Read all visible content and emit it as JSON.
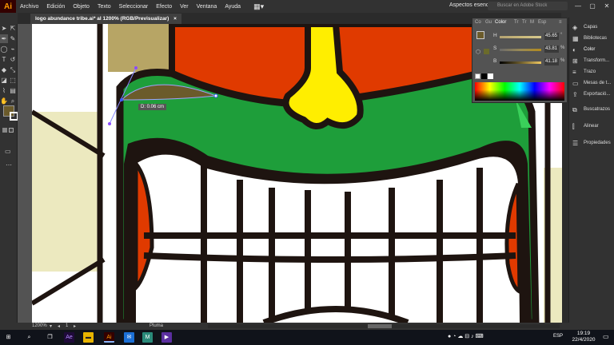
{
  "app": {
    "logo": "Ai",
    "workspace": "Aspectos esenciales",
    "search_placeholder": "Buscar en Adobe Stock"
  },
  "menu": [
    "Archivo",
    "Edición",
    "Objeto",
    "Texto",
    "Seleccionar",
    "Efecto",
    "Ver",
    "Ventana",
    "Ayuda"
  ],
  "document_tab": {
    "title": "logo abundance tribe.ai* al 1200% (RGB/Previsualizar)",
    "close": "×"
  },
  "measure_tooltip": "D: 0.06 cm",
  "color_panel": {
    "tabs": [
      "Co",
      "Gu",
      "Color",
      "Tr",
      "Tr",
      "M",
      "Esp"
    ],
    "sliders": [
      {
        "label": "H",
        "value": "45.65",
        "unit": "°",
        "color": "#c9b87a"
      },
      {
        "label": "S",
        "value": "43.81",
        "unit": "%",
        "color": "#9a8a55"
      },
      {
        "label": "B",
        "value": "41.18",
        "unit": "%",
        "color": "#6b5b2b"
      }
    ]
  },
  "right_dock": {
    "items": [
      {
        "label": "Capas",
        "icon": "layers-icon",
        "glyph": "◈"
      },
      {
        "label": "Bibliotecas",
        "icon": "libraries-icon",
        "glyph": "▦"
      },
      {
        "label": "Color",
        "icon": "color-icon",
        "glyph": "◐"
      },
      {
        "label": "Transform...",
        "icon": "transform-icon",
        "glyph": "⊞"
      },
      {
        "label": "Trazo",
        "icon": "stroke-icon",
        "glyph": "≡"
      },
      {
        "label": "Mesas de t...",
        "icon": "artboards-icon",
        "glyph": "▭"
      },
      {
        "label": "Exportació...",
        "icon": "export-icon",
        "glyph": "⇪"
      },
      {
        "label": "Buscatrazos",
        "icon": "pathfinder-icon",
        "glyph": "⧉"
      },
      {
        "label": "Alinear",
        "icon": "align-icon",
        "glyph": "⫿"
      },
      {
        "label": "Propiedades",
        "icon": "properties-icon",
        "glyph": "☰"
      }
    ]
  },
  "status": {
    "zoom": "1200%",
    "artboard": "1",
    "tool": "Pluma"
  },
  "taskbar": {
    "time": "19:19",
    "date": "22/4/2020",
    "lang": "ESP"
  },
  "colors": {
    "fill_swatch": "#6b5b2b",
    "green": "#1e9e3a",
    "orange_red": "#e03a00",
    "yellow": "#ffee00",
    "outline": "#1e1410",
    "beige": "#ece9bf",
    "tan": "#b7a565"
  }
}
